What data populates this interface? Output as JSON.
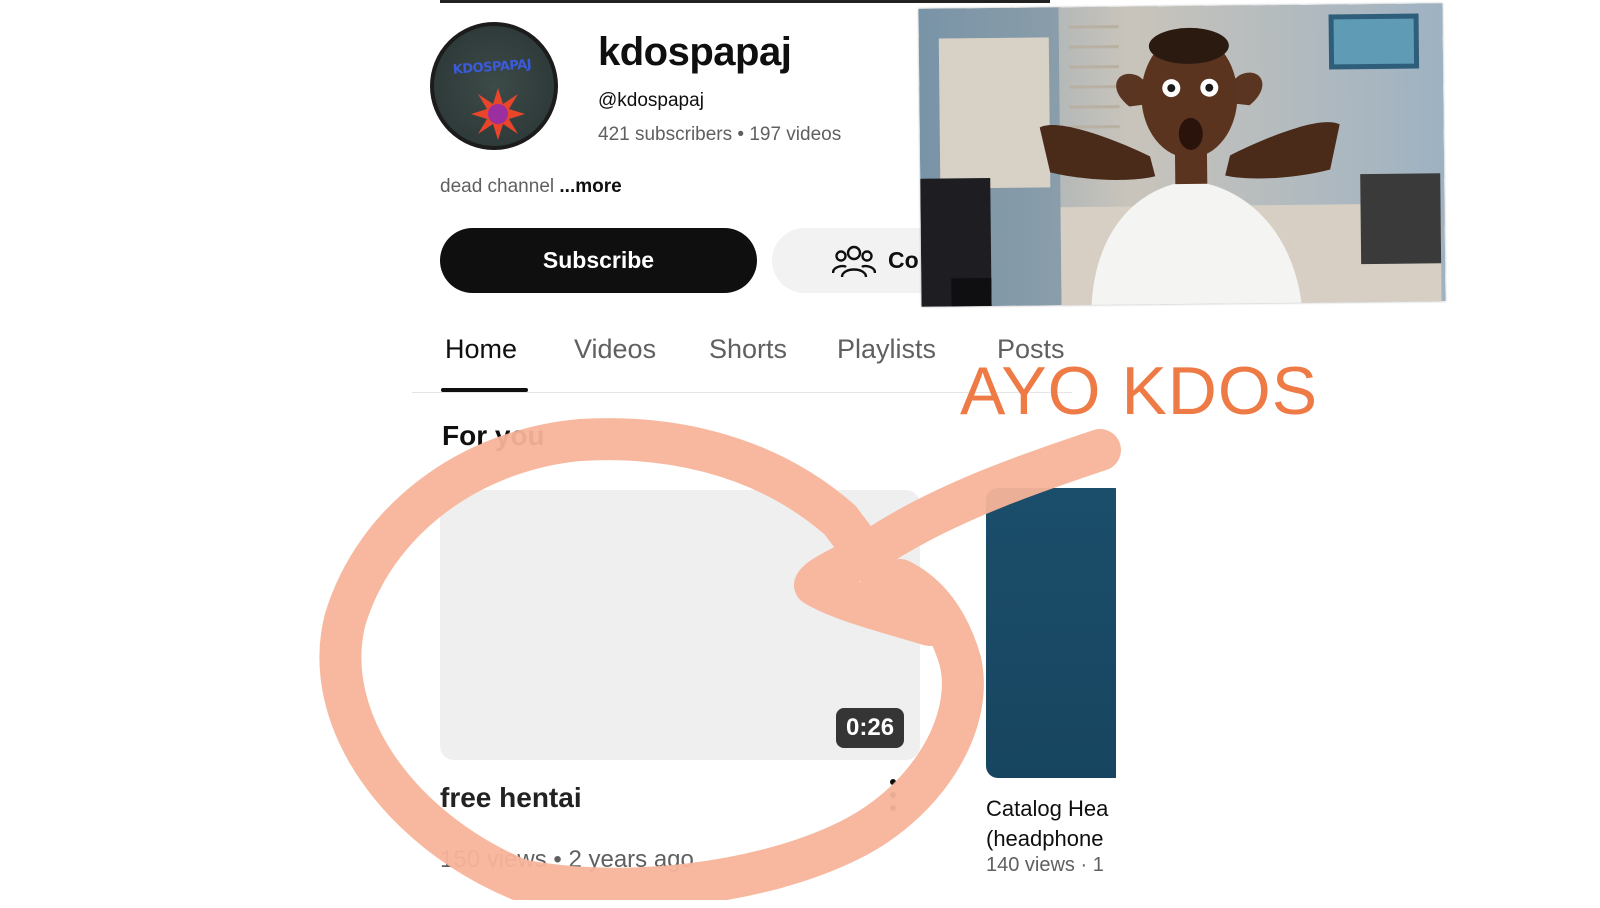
{
  "channel": {
    "name": "kdospapaj",
    "handle": "@kdospapaj",
    "stats": "421 subscribers • 197 videos",
    "description": "dead channel",
    "more_label": "...more",
    "avatar_text": "KDOSPAPAJ"
  },
  "actions": {
    "subscribe_label": "Subscribe",
    "community_label": "Co"
  },
  "tabs": [
    {
      "label": "Home",
      "active": true
    },
    {
      "label": "Videos",
      "active": false
    },
    {
      "label": "Shorts",
      "active": false
    },
    {
      "label": "Playlists",
      "active": false
    },
    {
      "label": "Posts",
      "active": false
    }
  ],
  "section": {
    "title": "For you"
  },
  "videos": [
    {
      "title": "free hentai",
      "duration": "0:26",
      "meta": "150 views • 2 years ago"
    },
    {
      "title": "Catalog Hea\n(headphone",
      "meta": "140 views · 1"
    }
  ],
  "overlay": {
    "caption": "AYO KDOS",
    "color": "#ee7a45",
    "scribble_color": "#f7b49a"
  },
  "icons": {
    "community": "people-icon",
    "more_actions": "more-vertical-icon"
  }
}
